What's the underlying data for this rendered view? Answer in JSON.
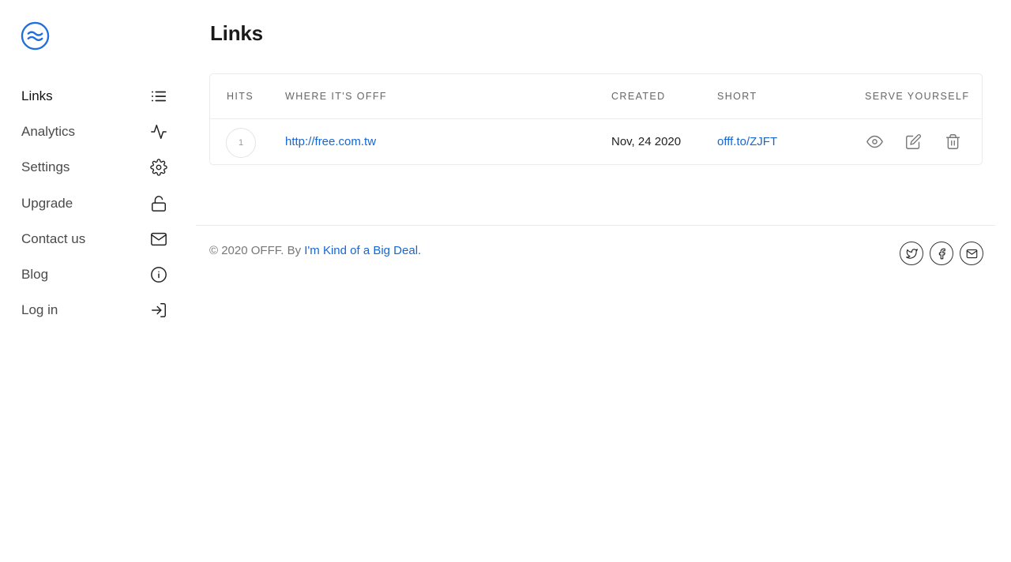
{
  "brand": {
    "logo_icon": "waves-icon",
    "accent": "#1f6fe0"
  },
  "sidebar": {
    "items": [
      {
        "label": "Links",
        "icon": "list-icon",
        "active": true
      },
      {
        "label": "Analytics",
        "icon": "activity-icon"
      },
      {
        "label": "Settings",
        "icon": "gear-icon"
      },
      {
        "label": "Upgrade",
        "icon": "unlock-icon"
      },
      {
        "label": "Contact us",
        "icon": "mail-icon"
      },
      {
        "label": "Blog",
        "icon": "info-icon"
      },
      {
        "label": "Log in",
        "icon": "log-in-icon"
      }
    ]
  },
  "main": {
    "title": "Links",
    "table": {
      "headers": {
        "hits": "HITS",
        "where": "WHERE IT'S OFFF",
        "created": "CREATED",
        "short": "SHORT",
        "serve": "SERVE YOURSELF"
      },
      "rows": [
        {
          "hits": "1",
          "url": "http://free.com.tw",
          "created": "Nov, 24 2020",
          "short": "offf.to/ZJFT",
          "actions": [
            "eye-icon",
            "edit-icon",
            "trash-icon"
          ]
        }
      ]
    }
  },
  "footer": {
    "copyright": "© 2020 OFFF. By",
    "credit_link": "I'm Kind of a Big Deal.",
    "social": [
      "twitter-icon",
      "facebook-icon",
      "mail-icon"
    ]
  },
  "colors": {
    "link": "#1666d4",
    "text": "#333333",
    "muted": "#777777",
    "border": "#ececec"
  }
}
